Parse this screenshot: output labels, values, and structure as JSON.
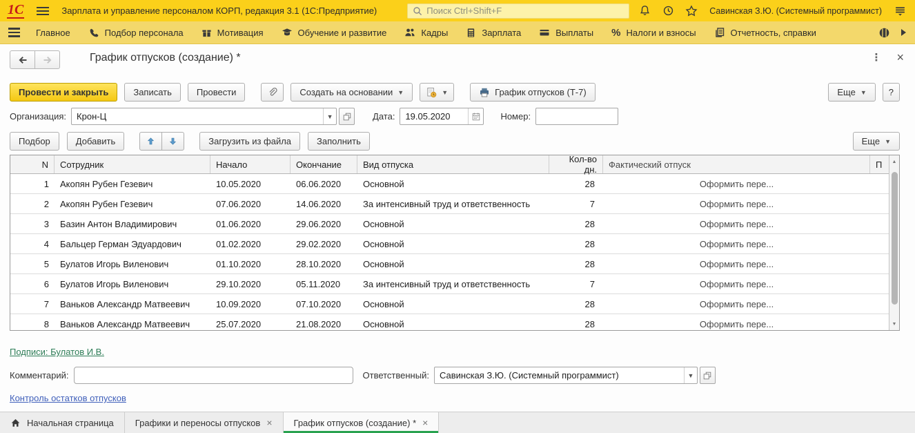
{
  "topbar": {
    "logo": "1С",
    "title": "Зарплата и управление персоналом КОРП, редакция 3.1  (1С:Предприятие)",
    "search_placeholder": "Поиск Ctrl+Shift+F",
    "user": "Савинская З.Ю. (Системный программист)"
  },
  "menubar": {
    "items": [
      {
        "label": "Главное"
      },
      {
        "label": "Подбор персонала"
      },
      {
        "label": "Мотивация"
      },
      {
        "label": "Обучение и развитие"
      },
      {
        "label": "Кадры"
      },
      {
        "label": "Зарплата"
      },
      {
        "label": "Выплаты"
      },
      {
        "label": "Налоги и взносы"
      },
      {
        "label": "Отчетность, справки"
      }
    ]
  },
  "page": {
    "title": "График отпусков (создание) *"
  },
  "toolbar": {
    "post_and_close": "Провести и закрыть",
    "save": "Записать",
    "post": "Провести",
    "create_based_on": "Создать на основании",
    "print_t7": "График отпусков (Т-7)",
    "more": "Еще",
    "help": "?"
  },
  "fields": {
    "org_label": "Организация:",
    "org_value": "Крон-Ц",
    "date_label": "Дата:",
    "date_value": "19.05.2020",
    "number_label": "Номер:",
    "number_value": ""
  },
  "table_toolbar": {
    "pick": "Подбор",
    "add": "Добавить",
    "load_from_file": "Загрузить из файла",
    "fill": "Заполнить",
    "more": "Еще"
  },
  "table": {
    "columns": [
      "N",
      "Сотрудник",
      "Начало",
      "Окончание",
      "Вид отпуска",
      "Кол-во дн.",
      "Фактический отпуск",
      "П"
    ],
    "rows": [
      {
        "n": "1",
        "employee": "Акопян Рубен Гезевич",
        "start": "10.05.2020",
        "end": "06.06.2020",
        "type": "Основной",
        "days": "28",
        "actual": "Оформить пере..."
      },
      {
        "n": "2",
        "employee": "Акопян Рубен Гезевич",
        "start": "07.06.2020",
        "end": "14.06.2020",
        "type": "За интенсивный труд и ответственность",
        "days": "7",
        "actual": "Оформить пере..."
      },
      {
        "n": "3",
        "employee": "Базин Антон Владимирович",
        "start": "01.06.2020",
        "end": "29.06.2020",
        "type": "Основной",
        "days": "28",
        "actual": "Оформить пере..."
      },
      {
        "n": "4",
        "employee": "Бальцер Герман Эдуардович",
        "start": "01.02.2020",
        "end": "29.02.2020",
        "type": "Основной",
        "days": "28",
        "actual": "Оформить пере..."
      },
      {
        "n": "5",
        "employee": "Булатов Игорь Виленович",
        "start": "01.10.2020",
        "end": "28.10.2020",
        "type": "Основной",
        "days": "28",
        "actual": "Оформить пере..."
      },
      {
        "n": "6",
        "employee": "Булатов Игорь Виленович",
        "start": "29.10.2020",
        "end": "05.11.2020",
        "type": "За интенсивный труд и ответственность",
        "days": "7",
        "actual": "Оформить пере..."
      },
      {
        "n": "7",
        "employee": "Ваньков Александр Матвеевич",
        "start": "10.09.2020",
        "end": "07.10.2020",
        "type": "Основной",
        "days": "28",
        "actual": "Оформить пере..."
      },
      {
        "n": "8",
        "employee": "Ваньков Александр Матвеевич",
        "start": "25.07.2020",
        "end": "21.08.2020",
        "type": "Основной",
        "days": "28",
        "actual": "Оформить пере..."
      }
    ]
  },
  "footer": {
    "signatures_link": "Подписи: Булатов И.В.",
    "comment_label": "Комментарий:",
    "comment_value": "",
    "responsible_label": "Ответственный:",
    "responsible_value": "Савинская З.Ю. (Системный программист)",
    "control_link": "Контроль остатков отпусков"
  },
  "tabs": [
    {
      "label": "Начальная страница"
    },
    {
      "label": "Графики и переносы отпусков"
    },
    {
      "label": "График отпусков (создание) *"
    }
  ],
  "colors": {
    "topbar_yellow": "#fbd01a",
    "menubar_yellow": "#f3d86b",
    "primary_button_yellow": "#f4c813",
    "active_tab_green": "#28a24f",
    "link_green": "#2e7d57",
    "link_blue": "#3f5fba",
    "logo_red": "#c51a1a"
  }
}
